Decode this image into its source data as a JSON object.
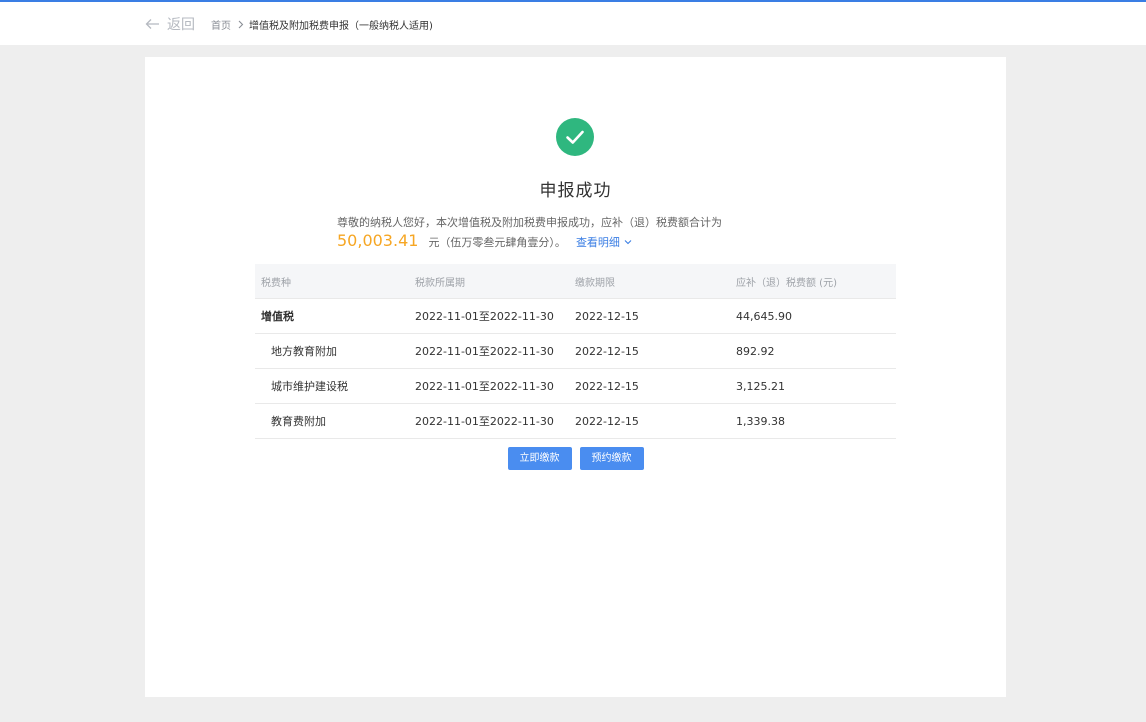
{
  "nav": {
    "back_label": "返回",
    "breadcrumb_home": "首页",
    "breadcrumb_current": "增值税及附加税费申报（一般纳税人适用)"
  },
  "result": {
    "title": "申报成功",
    "message": "尊敬的纳税人您好，本次增值税及附加税费申报成功，应补（退）税费额合计为",
    "amount": "50,003.41",
    "amount_words": "元（伍万零叁元肆角壹分）。",
    "detail_link": "查看明细"
  },
  "table": {
    "headers": [
      "税费种",
      "税款所属期",
      "缴款期限",
      "应补（退）税费额 (元)"
    ],
    "rows": [
      [
        "增值税",
        "2022-11-01至2022-11-30",
        "2022-12-15",
        "44,645.90"
      ],
      [
        "地方教育附加",
        "2022-11-01至2022-11-30",
        "2022-12-15",
        "892.92"
      ],
      [
        "城市维护建设税",
        "2022-11-01至2022-11-30",
        "2022-12-15",
        "3,125.21"
      ],
      [
        "教育费附加",
        "2022-11-01至2022-11-30",
        "2022-12-15",
        "1,339.38"
      ]
    ]
  },
  "actions": {
    "pay_now": "立即缴款",
    "schedule_pay": "预约缴款"
  },
  "colors": {
    "accent": "#3a7ee4",
    "button": "#4a8df0",
    "success": "#2fb77f",
    "amount": "#f6a623",
    "background": "#eeeeee"
  },
  "icons": {
    "back": "arrow-left-icon",
    "separator": "chevron-right-icon",
    "success": "check-circle-icon",
    "expand": "chevron-down-icon"
  }
}
